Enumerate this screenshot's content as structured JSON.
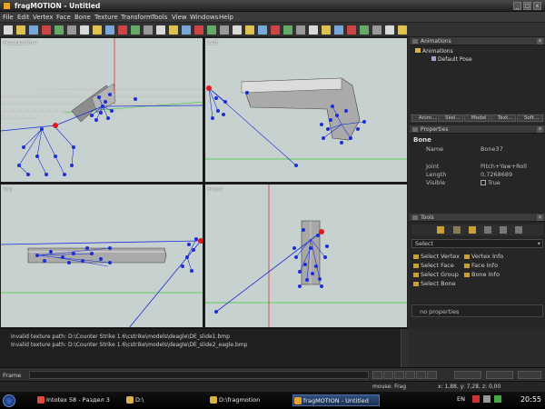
{
  "window": {
    "title": "fragMOTION - Untitled",
    "buttons": [
      "_",
      "□",
      "x"
    ]
  },
  "menu": [
    "File",
    "Edit",
    "Vertex",
    "Face",
    "Bone",
    "Texture",
    "Transform",
    "Tools",
    "View",
    "Windows",
    "Help"
  ],
  "toolbar": {
    "icons": [
      "new-file-icon",
      "open-icon",
      "save-icon",
      "undo-icon",
      "redo-icon",
      "cut-icon",
      "copy-icon",
      "paste-icon",
      "bone-icon",
      "bone-select-icon",
      "bone-add-icon",
      "bone-move-icon",
      "bone-rotate-icon",
      "bone-scale-icon",
      "bone-link-icon",
      "bone-mirror-icon",
      "bone-weight-icon",
      "view-front-icon",
      "view-side-icon",
      "view-top-icon",
      "record-icon",
      "vertex-select-icon",
      "face-select-icon",
      "object-select-icon",
      "axis-icon",
      "move-icon",
      "rotate-icon",
      "scale-icon",
      "snap-icon",
      "paint-icon",
      "wireframe-icon",
      "help-icon"
    ]
  },
  "viewports": [
    {
      "label": "Perspective"
    },
    {
      "label": "Left"
    },
    {
      "label": "Top"
    },
    {
      "label": "Front"
    }
  ],
  "panels": {
    "animations": {
      "title": "Animations",
      "tree": [
        "Animations",
        "Default Pose"
      ]
    },
    "tabs": [
      "Anim...",
      "Skel...",
      "Model",
      "Text...",
      "Soft..."
    ],
    "properties": {
      "title": "Properties",
      "section": "Bone",
      "rows": [
        {
          "key": "Name",
          "value": "Bone37"
        },
        {
          "key": "Joint",
          "value": "Pitch+Yaw+Roll"
        },
        {
          "key": "Length",
          "value": "0,7268689"
        },
        {
          "key": "Visible",
          "value": "True"
        }
      ]
    },
    "tools": {
      "title": "Tools",
      "select_value": "Select",
      "items_left": [
        "Select Vertex",
        "Select Face",
        "Select Group",
        "Select Bone"
      ],
      "items_right": [
        "Vertex Info",
        "Face Info",
        "Bone Info"
      ],
      "empty_text": "no properties"
    }
  },
  "console": {
    "lines": [
      "Invalid texture path: D:\\Counter Strike 1.6\\cstrike\\models\\deagle\\DE_slide1.bmp",
      "Invalid texture path: D:\\Counter Strike 1.6\\cstrike\\models\\deagle\\DE_slide2_eagle.bmp"
    ]
  },
  "frame": {
    "label": "Frame"
  },
  "status": {
    "mode": "mouse: Frag",
    "coords": "x: 1,88, y: 7,28, z: 0,00"
  },
  "taskbar": {
    "tasks": [
      {
        "label": "Intotex 58 - Раздел 3",
        "icon": "browser-icon",
        "color": "#e24c3d"
      },
      {
        "label": "D:\\",
        "icon": "folder-icon",
        "color": "#d9b24a"
      },
      {
        "label": "D:\\fragmotion",
        "icon": "folder-icon",
        "color": "#d9b24a"
      },
      {
        "label": "fragMOTION - Untitled",
        "icon": "fragmotion-icon",
        "color": "#e8a32b"
      }
    ],
    "lang": "EN",
    "clock": "20:55"
  }
}
